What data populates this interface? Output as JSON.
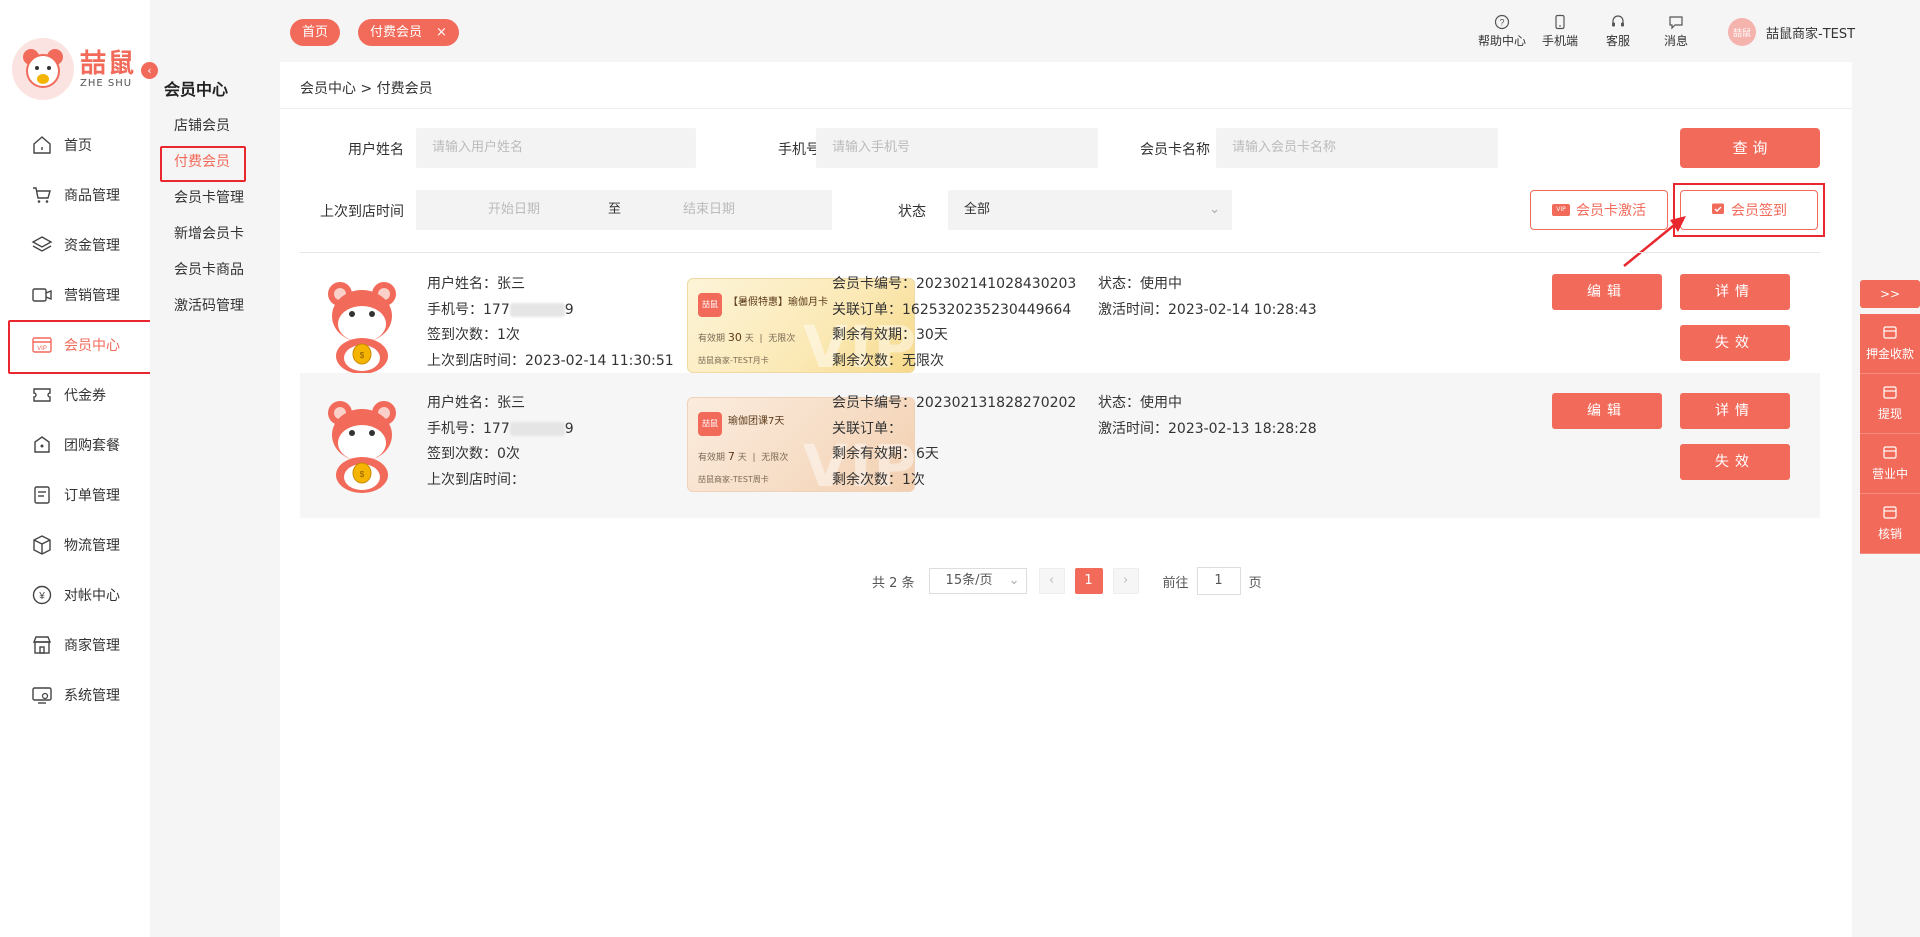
{
  "logo": {
    "cn": "喆鼠",
    "en": "ZHE SHU"
  },
  "nav": [
    {
      "label": "首页",
      "icon": "home-icon"
    },
    {
      "label": "商品管理",
      "icon": "cart-icon"
    },
    {
      "label": "资金管理",
      "icon": "layers-icon"
    },
    {
      "label": "营销管理",
      "icon": "marketing-icon"
    },
    {
      "label": "会员中心",
      "icon": "vip-icon",
      "active": true
    },
    {
      "label": "代金券",
      "icon": "coupon-icon"
    },
    {
      "label": "团购套餐",
      "icon": "group-icon"
    },
    {
      "label": "订单管理",
      "icon": "order-icon"
    },
    {
      "label": "物流管理",
      "icon": "box-icon"
    },
    {
      "label": "对帐中心",
      "icon": "yen-icon"
    },
    {
      "label": "商家管理",
      "icon": "store-icon"
    },
    {
      "label": "系统管理",
      "icon": "system-icon"
    }
  ],
  "subnav": {
    "title": "会员中心",
    "items": [
      "店铺会员",
      "付费会员",
      "会员卡管理",
      "新增会员卡",
      "会员卡商品",
      "激活码管理"
    ]
  },
  "tabs": {
    "home": "首页",
    "paid": "付费会员",
    "close": "×"
  },
  "top": {
    "help": "帮助中心",
    "mobile": "手机端",
    "service": "客服",
    "message": "消息",
    "user": "喆鼠商家-TEST",
    "avatar_text": "喆鼠"
  },
  "breadcrumb": "会员中心  > 付费会员",
  "filters": {
    "name_label": "用户姓名",
    "name_placeholder": "请输入用户姓名",
    "phone_label": "手机号",
    "phone_placeholder": "请输入手机号",
    "card_label": "会员卡名称",
    "card_placeholder": "请输入会员卡名称",
    "query": "查 询",
    "date_label": "上次到店时间",
    "start_placeholder": "开始日期",
    "to": "至",
    "end_placeholder": "结束日期",
    "status_label": "状态",
    "status_value": "全部",
    "activate": "会员卡激活",
    "checkin": "会员签到"
  },
  "rows": [
    {
      "name": "用户姓名：张三",
      "phone_prefix": "手机号：177",
      "phone_suffix": "9",
      "checkins": "签到次数：1次",
      "last_visit": "上次到店时间：2023-02-14 11:30:51",
      "card_name": "【暑假特惠】瑜伽月卡",
      "card_valid_label": "有效期",
      "card_valid_num": "30",
      "card_valid_unit": "天",
      "card_times": "无限次",
      "card_shop": "喆鼠商家-TEST月卡",
      "card_no": "会员卡编号：202302141028430203",
      "order": "关联订单：1625320235230449664",
      "remain_days": "剩余有效期：30天",
      "remain_times": "剩余次数：无限次",
      "status": "状态：使用中",
      "activated": "激活时间：2023-02-14 10:28:43"
    },
    {
      "name": "用户姓名：张三",
      "phone_prefix": "手机号：177",
      "phone_suffix": "9",
      "checkins": "签到次数：0次",
      "last_visit": "上次到店时间：",
      "card_name": "瑜伽团课7天",
      "card_valid_label": "有效期",
      "card_valid_num": "7",
      "card_valid_unit": "天",
      "card_times": "无限次",
      "card_shop": "喆鼠商家-TEST周卡",
      "card_no": "会员卡编号：202302131828270202",
      "order": "关联订单：",
      "remain_days": "剩余有效期：6天",
      "remain_times": "剩余次数：1次",
      "status": "状态：使用中",
      "activated": "激活时间：2023-02-13 18:28:28"
    }
  ],
  "row_buttons": {
    "edit": "编辑",
    "detail": "详情",
    "invalid": "失效"
  },
  "card_logo": "喆鼠",
  "card_vip": "VIP",
  "pager": {
    "total": "共 2 条",
    "per_page": "15条/页",
    "prev": "‹",
    "current": "1",
    "next": "›",
    "goto": "前往",
    "page_value": "1",
    "page_unit": "页"
  },
  "rtool": {
    "toggle": ">>",
    "items": [
      "押金收款",
      "提现",
      "营业中",
      "核销"
    ]
  },
  "colors": {
    "accent": "#f26a5a",
    "highlight": "#e8272f"
  }
}
